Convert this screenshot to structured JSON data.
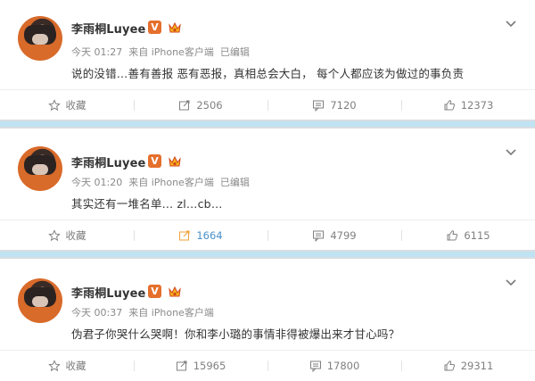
{
  "colors": {
    "accent": "#4a90c8",
    "text": "#333333",
    "meta": "#8a8a8a",
    "separator": "#bfe3f2",
    "verified": "#e56f2c"
  },
  "posts": [
    {
      "author": "李雨桐Luyee",
      "verified_badge": "V",
      "time": "今天 01:27",
      "source": "来自 iPhone客户端",
      "edited": "已编辑",
      "text": "说的没错…善有善报 恶有恶报，真相总会大白， 每个人都应该为做过的事负责",
      "actions": {
        "favorite": "收藏",
        "repost": "2506",
        "comment": "7120",
        "like": "12373"
      }
    },
    {
      "author": "李雨桐Luyee",
      "verified_badge": "V",
      "time": "今天 01:20",
      "source": "来自 iPhone客户端",
      "edited": "已编辑",
      "text": "其实还有一堆名单… zl…cb…",
      "actions": {
        "favorite": "收藏",
        "repost": "1664",
        "comment": "4799",
        "like": "6115"
      }
    },
    {
      "author": "李雨桐Luyee",
      "verified_badge": "V",
      "time": "今天 00:37",
      "source": "来自 iPhone客户端",
      "edited": "",
      "text": "伪君子你哭什么哭啊！你和李小璐的事情非得被爆出来才甘心吗？",
      "actions": {
        "favorite": "收藏",
        "repost": "15965",
        "comment": "17800",
        "like": "29311"
      }
    }
  ],
  "icons": [
    "star-icon",
    "repost-icon",
    "comment-icon",
    "like-icon",
    "chevron-down-icon",
    "crown-icon"
  ]
}
